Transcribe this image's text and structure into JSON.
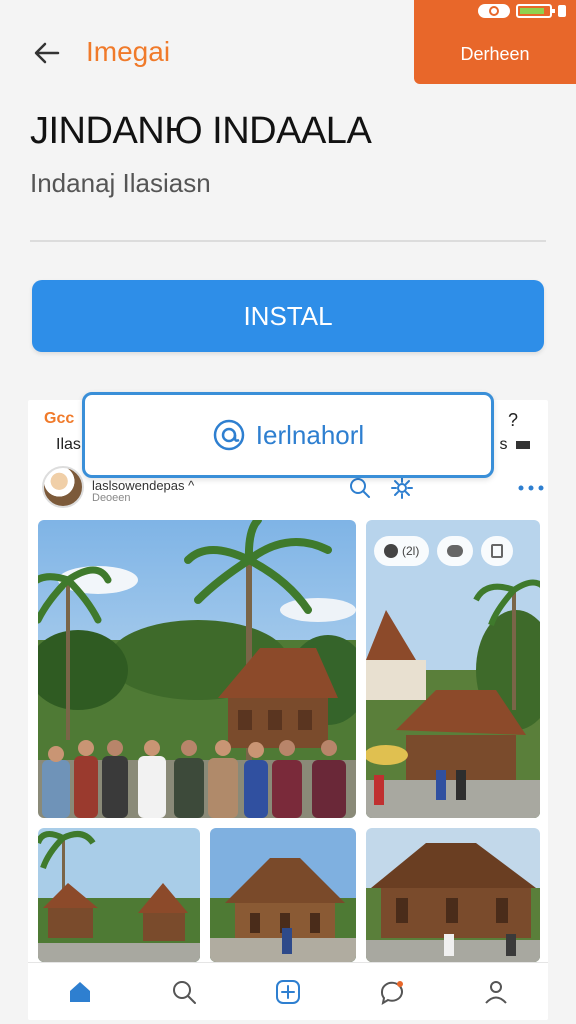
{
  "header": {
    "brand": "Imegai",
    "action_label": "Derheen"
  },
  "app": {
    "title": "JINDANЮ INDAALA",
    "subtitle": "Indanaj Ilasiasn"
  },
  "install_label": "INSTAL",
  "floating": {
    "label": "Ierlnahorl"
  },
  "card": {
    "top_left": "Gcc",
    "top_left_2": "Ilas",
    "top_right": "?",
    "top_right_2": "s",
    "profile_name": "laslsowendepas ^",
    "profile_sub": "Deoeen",
    "chips": [
      "(2l)",
      "",
      ""
    ]
  },
  "colors": {
    "accent": "#2e8ee8",
    "brand_orange": "#e8672a"
  },
  "icons": {
    "back": "arrow-left-icon",
    "search": "search-icon",
    "gear": "gear-icon",
    "more": "more-dots-icon",
    "home": "home-icon",
    "add": "add-icon",
    "chat": "chat-icon",
    "profile": "profile-icon",
    "at": "at-icon"
  }
}
